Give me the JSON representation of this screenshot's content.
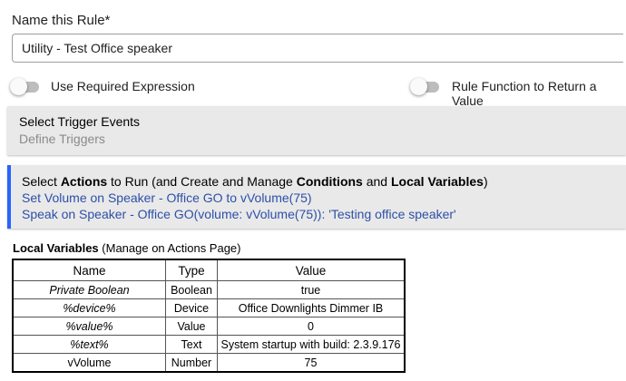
{
  "rule_name": {
    "label": "Name this Rule*",
    "value": "Utility - Test Office speaker"
  },
  "toggles": {
    "required_expression": {
      "label": "Use Required Expression",
      "on": false
    },
    "rule_function": {
      "label": "Rule Function to Return a Value",
      "on": false
    }
  },
  "triggers": {
    "title": "Select Trigger Events",
    "subtitle": "Define Triggers"
  },
  "actions": {
    "title_parts": [
      "Select ",
      "Actions",
      " to Run (and Create and Manage ",
      "Conditions",
      " and ",
      "Local Variables",
      ")"
    ],
    "lines": [
      "Set Volume on Speaker - Office GO to vVolume(75)",
      "Speak on Speaker - Office GO(volume: vVolume(75)): 'Testing office speaker'"
    ],
    "accent_color": "#2962ff",
    "link_color": "#2e4fa8"
  },
  "local_variables": {
    "heading_bold": "Local Variables",
    "heading_note": " (Manage on Actions Page)",
    "columns": [
      "Name",
      "Type",
      "Value"
    ],
    "rows": [
      {
        "name": "Private Boolean",
        "type": "Boolean",
        "value": "true"
      },
      {
        "name": "%device%",
        "type": "Device",
        "value": "Office Downlights Dimmer IB"
      },
      {
        "name": "%value%",
        "type": "Value",
        "value": "0"
      },
      {
        "name": "%text%",
        "type": "Text",
        "value": "System startup with build: 2.3.9.176"
      },
      {
        "name": "vVolume",
        "type": "Number",
        "value": "75"
      }
    ]
  }
}
